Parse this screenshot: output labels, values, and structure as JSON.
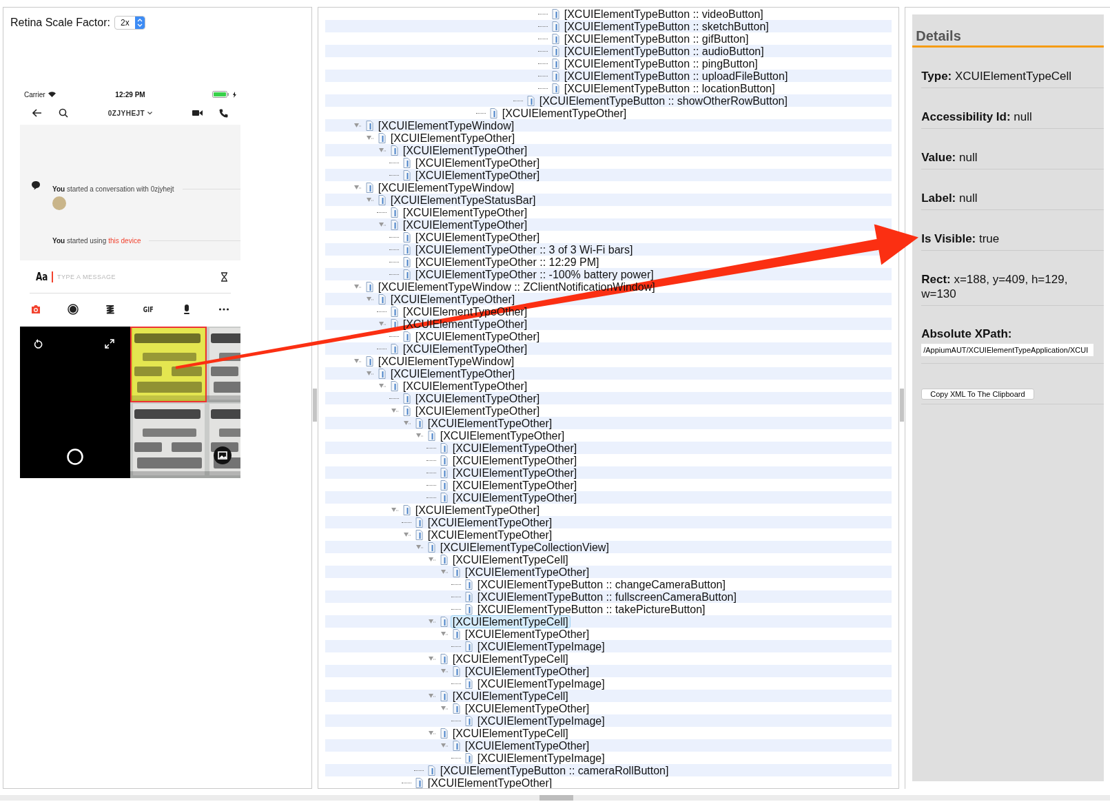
{
  "inspector": {
    "scale_label": "Retina Scale Factor:",
    "scale_value": "2x"
  },
  "phone": {
    "status": {
      "carrier": "Carrier",
      "time": "12:29 PM"
    },
    "nav": {
      "title": "0ZJYHEJT"
    },
    "events": [
      {
        "text": "**You** started a conversation with 0zjyhejt",
        "avatar": true
      },
      {
        "text": "**You** started using",
        "link": "this device"
      }
    ],
    "composer": {
      "format": "Aa",
      "placeholder": "TYPE A MESSAGE"
    },
    "tools": [
      {
        "kind": "camera",
        "selected": true
      },
      {
        "kind": "record",
        "selected": false
      },
      {
        "kind": "sketch",
        "selected": false
      },
      {
        "kind": "gif",
        "label": "GIF",
        "selected": false
      },
      {
        "kind": "audio",
        "selected": false
      },
      {
        "kind": "more",
        "selected": false
      }
    ],
    "media": [
      {
        "kind": "camera"
      },
      {
        "kind": "picture",
        "highlighted": true
      },
      {
        "kind": "picture",
        "highlighted": false
      },
      {
        "kind": "picture",
        "highlighted": false
      },
      {
        "kind": "picture",
        "highlighted": false
      }
    ]
  },
  "tree": {
    "nodes": [
      {
        "children": [
          {
            "children": [
              {
                "children": [
                  {
                    "children": [
                      {
                        "children": [
                          {
                            "children": [
                              {
                                "children": [
                                  {
                                    "children": [
                                      {
                                        "children": [
                                          {
                                            "children": [
                                              {
                                                "children": [
                                                  {
                                                    "children": [
                                                      {
                                                        "children": [
                                                          {
                                                            "children": [
                                                              {
                                                                "children": [
                                                                  {
                                                                    "label": "[XCUIElementTypeButton :: videoButton]",
                                                                    "selected": false
                                                                  },
                                                                  {
                                                                    "label": "[XCUIElementTypeButton :: sketchButton]",
                                                                    "selected": false
                                                                  },
                                                                  {
                                                                    "label": "[XCUIElementTypeButton :: gifButton]",
                                                                    "selected": false
                                                                  },
                                                                  {
                                                                    "label": "[XCUIElementTypeButton :: audioButton]",
                                                                    "selected": false
                                                                  },
                                                                  {
                                                                    "label": "[XCUIElementTypeButton :: pingButton]",
                                                                    "selected": false
                                                                  },
                                                                  {
                                                                    "label": "[XCUIElementTypeButton :: uploadFileButton]",
                                                                    "selected": false
                                                                  },
                                                                  {
                                                                    "label": "[XCUIElementTypeButton :: locationButton]",
                                                                    "selected": false
                                                                  }
                                                                ]
                                                              }
                                                            ]
                                                          },
                                                          {
                                                            "label": "[XCUIElementTypeButton :: showOtherRowButton]",
                                                            "selected": false
                                                          }
                                                        ]
                                                      }
                                                    ]
                                                  }
                                                ]
                                              },
                                              {
                                                "label": "[XCUIElementTypeOther]",
                                                "selected": false
                                              }
                                            ]
                                          }
                                        ]
                                      }
                                    ]
                                  }
                                ]
                              }
                            ]
                          }
                        ]
                      }
                    ]
                  }
                ]
              }
            ]
          }
        ]
      },
      {
        "label": "[XCUIElementTypeWindow]",
        "selected": false,
        "expanded": true,
        "children": [
          {
            "label": "[XCUIElementTypeOther]",
            "selected": false,
            "expanded": true,
            "children": [
              {
                "label": "[XCUIElementTypeOther]",
                "selected": false,
                "expanded": true,
                "children": [
                  {
                    "label": "[XCUIElementTypeOther]",
                    "selected": false
                  },
                  {
                    "label": "[XCUIElementTypeOther]",
                    "selected": false
                  }
                ]
              }
            ]
          }
        ]
      },
      {
        "label": "[XCUIElementTypeWindow]",
        "selected": false,
        "expanded": true,
        "children": [
          {
            "label": "[XCUIElementTypeStatusBar]",
            "selected": false,
            "expanded": true,
            "children": [
              {
                "label": "[XCUIElementTypeOther]",
                "selected": false
              },
              {
                "label": "[XCUIElementTypeOther]",
                "selected": false,
                "expanded": true,
                "children": [
                  {
                    "label": "[XCUIElementTypeOther]",
                    "selected": false
                  },
                  {
                    "label": "[XCUIElementTypeOther :: 3 of 3 Wi-Fi bars]",
                    "selected": false
                  },
                  {
                    "label": "[XCUIElementTypeOther :: 12:29 PM]",
                    "selected": false
                  },
                  {
                    "label": "[XCUIElementTypeOther :: -100% battery power]",
                    "selected": false
                  }
                ]
              }
            ]
          }
        ]
      },
      {
        "label": "[XCUIElementTypeWindow :: ZClientNotificationWindow]",
        "selected": false,
        "expanded": true,
        "children": [
          {
            "label": "[XCUIElementTypeOther]",
            "selected": false,
            "expanded": true,
            "children": [
              {
                "label": "[XCUIElementTypeOther]",
                "selected": false
              },
              {
                "label": "[XCUIElementTypeOther]",
                "selected": false,
                "expanded": true,
                "children": [
                  {
                    "label": "[XCUIElementTypeOther]",
                    "selected": false
                  }
                ]
              },
              {
                "label": "[XCUIElementTypeOther]",
                "selected": false
              }
            ]
          }
        ]
      },
      {
        "label": "[XCUIElementTypeWindow]",
        "selected": false,
        "expanded": true,
        "children": [
          {
            "label": "[XCUIElementTypeOther]",
            "selected": false,
            "expanded": true,
            "children": [
              {
                "label": "[XCUIElementTypeOther]",
                "selected": false,
                "expanded": true,
                "children": [
                  {
                    "label": "[XCUIElementTypeOther]",
                    "selected": false
                  },
                  {
                    "label": "[XCUIElementTypeOther]",
                    "selected": false,
                    "expanded": true,
                    "children": [
                      {
                        "label": "[XCUIElementTypeOther]",
                        "selected": false,
                        "expanded": true,
                        "children": [
                          {
                            "label": "[XCUIElementTypeOther]",
                            "selected": false,
                            "expanded": true,
                            "children": [
                              {
                                "label": "[XCUIElementTypeOther]",
                                "selected": false
                              },
                              {
                                "label": "[XCUIElementTypeOther]",
                                "selected": false
                              },
                              {
                                "label": "[XCUIElementTypeOther]",
                                "selected": false
                              },
                              {
                                "label": "[XCUIElementTypeOther]",
                                "selected": false
                              },
                              {
                                "label": "[XCUIElementTypeOther]",
                                "selected": false
                              }
                            ]
                          }
                        ]
                      }
                    ]
                  },
                  {
                    "label": "[XCUIElementTypeOther]",
                    "selected": false,
                    "expanded": true,
                    "children": [
                      {
                        "label": "[XCUIElementTypeOther]",
                        "selected": false
                      },
                      {
                        "label": "[XCUIElementTypeOther]",
                        "selected": false,
                        "expanded": true,
                        "children": [
                          {
                            "label": "[XCUIElementTypeCollectionView]",
                            "selected": false,
                            "expanded": true,
                            "children": [
                              {
                                "label": "[XCUIElementTypeCell]",
                                "selected": false,
                                "expanded": true,
                                "children": [
                                  {
                                    "label": "[XCUIElementTypeOther]",
                                    "selected": false,
                                    "expanded": true,
                                    "children": [
                                      {
                                        "label": "[XCUIElementTypeButton :: changeCameraButton]",
                                        "selected": false
                                      },
                                      {
                                        "label": "[XCUIElementTypeButton :: fullscreenCameraButton]",
                                        "selected": false
                                      },
                                      {
                                        "label": "[XCUIElementTypeButton :: takePictureButton]",
                                        "selected": false
                                      }
                                    ]
                                  }
                                ]
                              },
                              {
                                "label": "[XCUIElementTypeCell]",
                                "selected": true,
                                "expanded": true,
                                "children": [
                                  {
                                    "label": "[XCUIElementTypeOther]",
                                    "selected": false,
                                    "expanded": true,
                                    "children": [
                                      {
                                        "label": "[XCUIElementTypeImage]",
                                        "selected": false
                                      }
                                    ]
                                  }
                                ]
                              },
                              {
                                "label": "[XCUIElementTypeCell]",
                                "selected": false,
                                "expanded": true,
                                "children": [
                                  {
                                    "label": "[XCUIElementTypeOther]",
                                    "selected": false,
                                    "expanded": true,
                                    "children": [
                                      {
                                        "label": "[XCUIElementTypeImage]",
                                        "selected": false
                                      }
                                    ]
                                  }
                                ]
                              },
                              {
                                "label": "[XCUIElementTypeCell]",
                                "selected": false,
                                "expanded": true,
                                "children": [
                                  {
                                    "label": "[XCUIElementTypeOther]",
                                    "selected": false,
                                    "expanded": true,
                                    "children": [
                                      {
                                        "label": "[XCUIElementTypeImage]",
                                        "selected": false
                                      }
                                    ]
                                  }
                                ]
                              },
                              {
                                "label": "[XCUIElementTypeCell]",
                                "selected": false,
                                "expanded": true,
                                "children": [
                                  {
                                    "label": "[XCUIElementTypeOther]",
                                    "selected": false,
                                    "expanded": true,
                                    "children": [
                                      {
                                        "label": "[XCUIElementTypeImage]",
                                        "selected": false
                                      }
                                    ]
                                  }
                                ]
                              }
                            ]
                          },
                          {
                            "label": "[XCUIElementTypeButton :: cameraRollButton]",
                            "selected": false
                          }
                        ]
                      },
                      {
                        "label": "[XCUIElementTypeOther]",
                        "selected": false
                      }
                    ]
                  }
                ]
              }
            ]
          }
        ]
      }
    ]
  },
  "details": {
    "title": "Details",
    "fields": [
      {
        "text": "**Type:** XCUIElementTypeCell"
      },
      {
        "text": "**Accessibility Id:** null"
      },
      {
        "text": "**Value:** null"
      },
      {
        "text": "**Label:** null"
      },
      {
        "text": "**Is Visible:** true"
      },
      {
        "text": "**Rect:** x=188, y=409, h=129, w=130"
      }
    ],
    "xpath": {
      "label": "Absolute XPath:",
      "value": "/AppiumAUT/XCUIElementTypeApplication/XCUI"
    },
    "copy_button": "Copy XML To The Clipboard"
  }
}
